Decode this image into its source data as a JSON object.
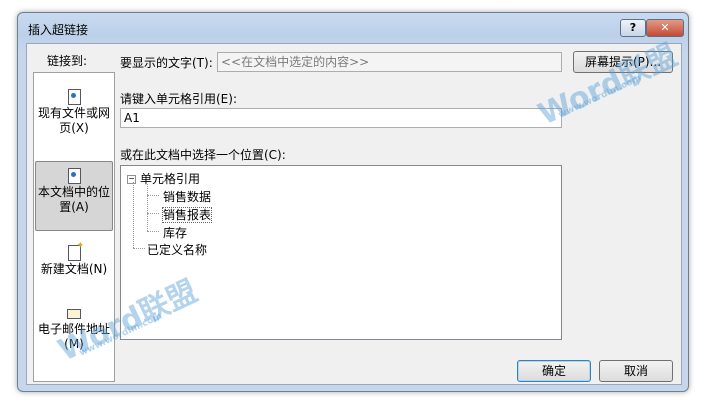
{
  "dialog": {
    "title": "插入超链接",
    "help_label": "?",
    "close_label": "✕"
  },
  "left": {
    "link_to_label": "链接到:",
    "items": [
      {
        "label": "现有文件或网页(X)",
        "icon": "file-web-icon"
      },
      {
        "label": "本文档中的位置(A)",
        "icon": "document-place-icon",
        "active": true
      },
      {
        "label": "新建文档(N)",
        "icon": "new-document-icon"
      },
      {
        "label": "电子邮件地址(M)",
        "icon": "email-icon"
      }
    ]
  },
  "text_to_display": {
    "label": "要显示的文字(T):",
    "value": "<<在文档中选定的内容>>"
  },
  "screen_tip_button": "屏幕提示(P)...",
  "cell_ref": {
    "label": "请键入单元格引用(E):",
    "value": "A1"
  },
  "place": {
    "label": "或在此文档中选择一个位置(C):",
    "tree": {
      "root1": "单元格引用",
      "children": [
        "销售数据",
        "销售报表",
        "库存"
      ],
      "root2": "已定义名称",
      "selected": "销售报表"
    }
  },
  "buttons": {
    "ok": "确定",
    "cancel": "取消"
  },
  "watermark": {
    "brand": "Word联盟",
    "url": "www.wordlm.com"
  }
}
